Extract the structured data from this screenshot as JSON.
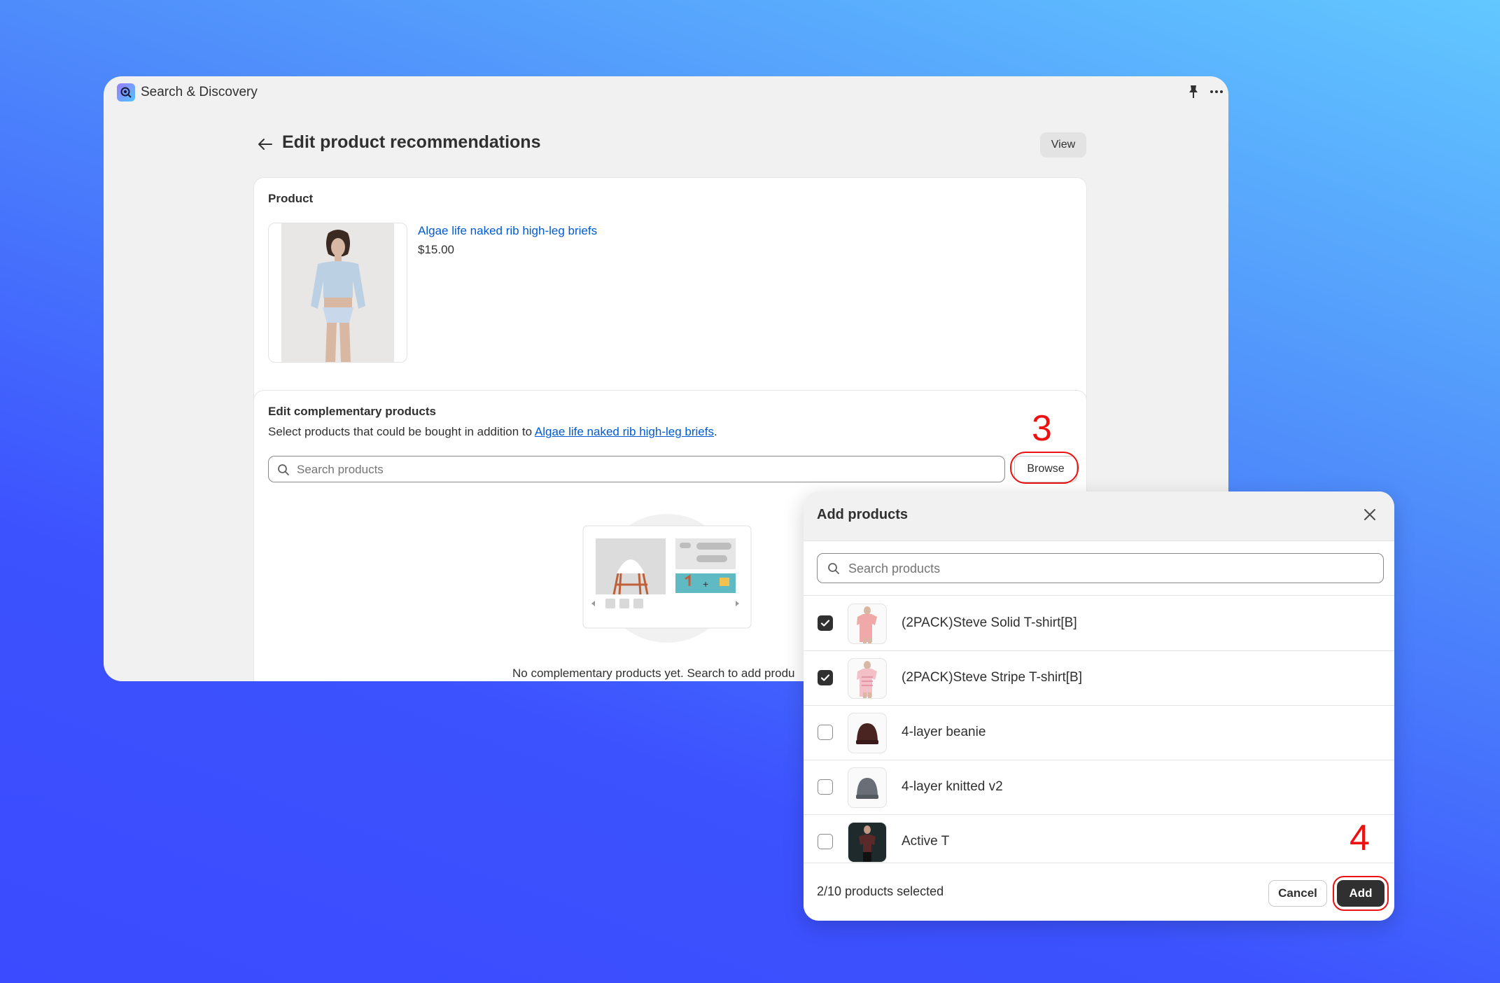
{
  "app": {
    "name": "Search & Discovery"
  },
  "page": {
    "title": "Edit product recommendations",
    "view_label": "View"
  },
  "product_card": {
    "heading": "Product",
    "product_name": "Algae life naked rib high-leg briefs",
    "price": "$15.00"
  },
  "complementary": {
    "heading": "Edit complementary products",
    "desc_prefix": "Select products that could be bought in addition to ",
    "desc_link": "Algae life naked rib high-leg briefs",
    "desc_suffix": ".",
    "search_placeholder": "Search products",
    "browse_label": "Browse",
    "empty_text": "No complementary products yet. Search to add produ"
  },
  "annotations": {
    "step_browse": "3",
    "step_add": "4"
  },
  "modal": {
    "title": "Add products",
    "search_placeholder": "Search products",
    "items": [
      {
        "label": "(2PACK)Steve Solid T-shirt[B]",
        "checked": true,
        "thumb": "pink-tshirt"
      },
      {
        "label": "(2PACK)Steve Stripe T-shirt[B]",
        "checked": true,
        "thumb": "striped-tshirt"
      },
      {
        "label": "4-layer beanie",
        "checked": false,
        "thumb": "brown-beanie"
      },
      {
        "label": "4-layer knitted v2",
        "checked": false,
        "thumb": "grey-beanie"
      },
      {
        "label": "Active T",
        "checked": false,
        "thumb": "person-dark-tshirt"
      }
    ],
    "selected_count": "2/10 products selected",
    "cancel_label": "Cancel",
    "add_label": "Add"
  },
  "colors": {
    "accent_link": "#005bd3",
    "primary_button": "#303030",
    "annotation_red": "#ee1111"
  }
}
